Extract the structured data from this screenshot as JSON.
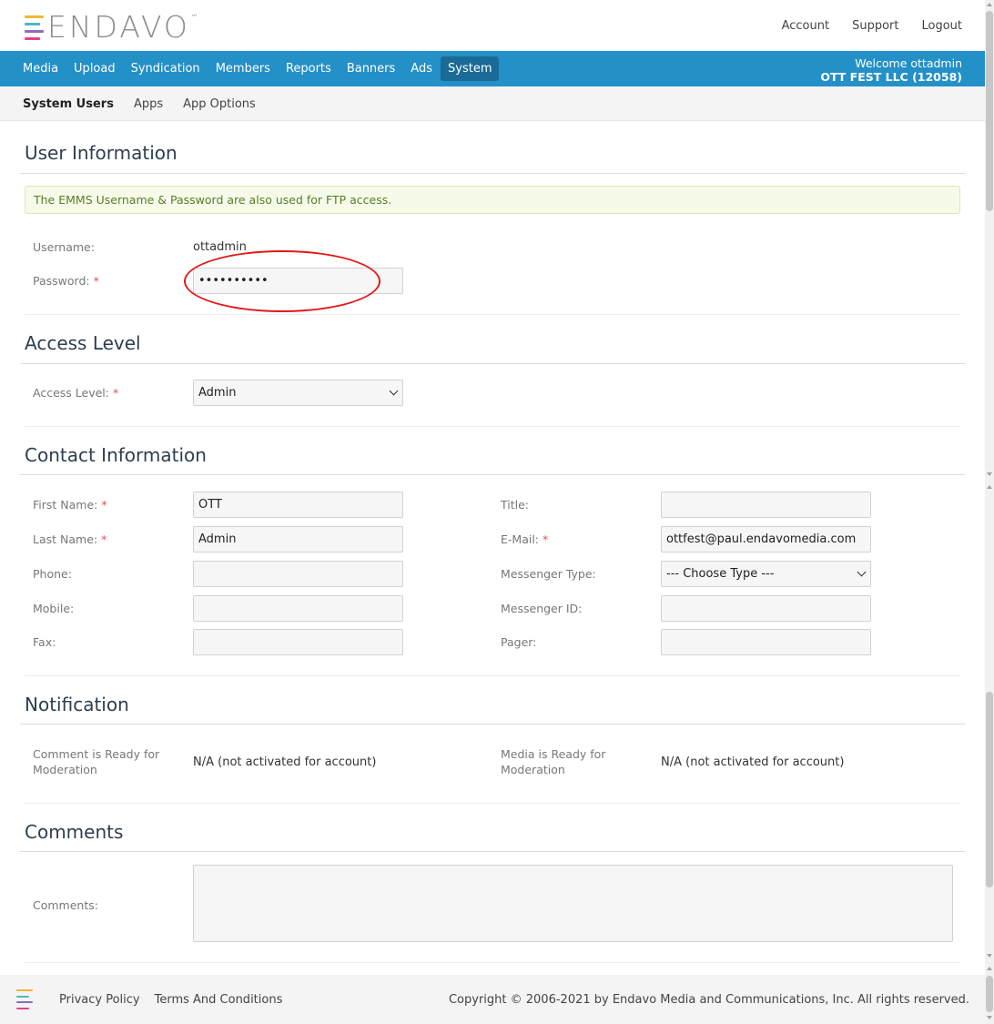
{
  "brand": {
    "name": "ENDAVO",
    "tm": "™",
    "colors": [
      "#f2b632",
      "#4cb8c4",
      "#8e6bbf",
      "#e0458c"
    ]
  },
  "top_links": [
    "Account",
    "Support",
    "Logout"
  ],
  "main_nav": {
    "items": [
      "Media",
      "Upload",
      "Syndication",
      "Members",
      "Reports",
      "Banners",
      "Ads",
      "System"
    ],
    "active": "System",
    "welcome": "Welcome ottadmin",
    "company": "OTT FEST LLC (12058)"
  },
  "sub_nav": {
    "items": [
      "System Users",
      "Apps",
      "App Options"
    ],
    "active": "System Users"
  },
  "user_info": {
    "title": "User Information",
    "alert": "The EMMS Username & Password are also used for FTP access.",
    "username_label": "Username:",
    "username_value": "ottadmin",
    "password_label": "Password:",
    "password_value": "••••••••••"
  },
  "access_level": {
    "title": "Access Level",
    "label": "Access Level:",
    "selected": "Admin"
  },
  "contact": {
    "title": "Contact Information",
    "first_name_label": "First Name:",
    "first_name_value": "OTT",
    "last_name_label": "Last Name:",
    "last_name_value": "Admin",
    "phone_label": "Phone:",
    "phone_value": "",
    "mobile_label": "Mobile:",
    "mobile_value": "",
    "fax_label": "Fax:",
    "fax_value": "",
    "title_label": "Title:",
    "title_value": "",
    "email_label": "E-Mail:",
    "email_value": "ottfest@paul.endavomedia.com",
    "messenger_type_label": "Messenger Type:",
    "messenger_type_selected": "--- Choose Type ---",
    "messenger_id_label": "Messenger ID:",
    "messenger_id_value": "",
    "pager_label": "Pager:",
    "pager_value": ""
  },
  "notification": {
    "title": "Notification",
    "comment_label": "Comment is Ready for Moderation",
    "comment_value": "N/A (not activated for account)",
    "media_label": "Media is Ready for Moderation",
    "media_value": "N/A (not activated for account)"
  },
  "comments": {
    "title": "Comments",
    "label": "Comments:",
    "value": ""
  },
  "footer": {
    "links": [
      "Privacy Policy",
      "Terms And Conditions"
    ],
    "copyright": "Copyright © 2006-2021 by Endavo Media and Communications, Inc. All rights reserved."
  },
  "required_marker": "*",
  "annotation_color": "#e01a1a"
}
